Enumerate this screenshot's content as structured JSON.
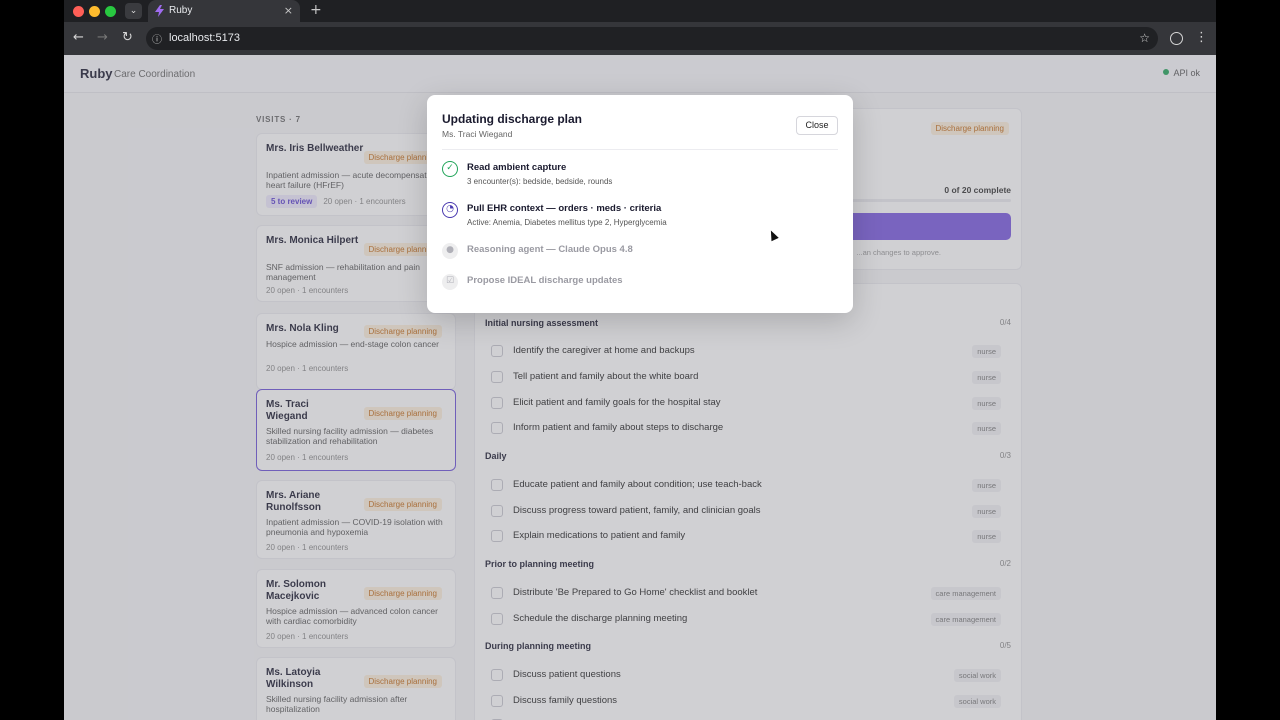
{
  "browser": {
    "tab_title": "Ruby",
    "url": "localhost:5173"
  },
  "app": {
    "brand": "Ruby",
    "section": "Care Coordination",
    "api_status": "API ok"
  },
  "visits": {
    "label": "VISITS · 7",
    "items": [
      {
        "name": "Mrs. Iris Bellweather",
        "badge": "Discharge planning",
        "desc": "Inpatient admission — acute decompensated heart failure (HFrEF)",
        "review": "5 to review",
        "meta": "20 open · 1 encounters"
      },
      {
        "name": "Mrs. Monica Hilpert",
        "badge": "Discharge planning",
        "desc": "SNF admission — rehabilitation and pain management",
        "review": "",
        "meta": "20 open · 1 encounters"
      },
      {
        "name": "Mrs. Nola Kling",
        "badge": "Discharge planning",
        "desc": "Hospice admission — end-stage colon cancer",
        "review": "",
        "meta": "20 open · 1 encounters"
      },
      {
        "name": "Ms. Traci Wiegand",
        "badge": "Discharge planning",
        "desc": "Skilled nursing facility admission — diabetes stabilization and rehabilitation",
        "review": "",
        "meta": "20 open · 1 encounters"
      },
      {
        "name": "Mrs. Ariane Runolfsson",
        "badge": "Discharge planning",
        "desc": "Inpatient admission — COVID-19 isolation with pneumonia and hypoxemia",
        "review": "",
        "meta": "20 open · 1 encounters"
      },
      {
        "name": "Mr. Solomon Macejkovic",
        "badge": "Discharge planning",
        "desc": "Hospice admission — advanced colon cancer with cardiac comorbidity",
        "review": "",
        "meta": "20 open · 1 encounters"
      },
      {
        "name": "Ms. Latoyia Wilkinson",
        "badge": "Discharge planning",
        "desc": "Skilled nursing facility admission after hospitalization",
        "review": "",
        "meta": ""
      }
    ]
  },
  "detail": {
    "badge": "Discharge planning",
    "progress_text": "0 of 20 complete",
    "progress_fraction": 0,
    "hint": "...an changes to approve."
  },
  "sections": [
    {
      "title": "Initial nursing assessment",
      "count": "0/4",
      "tasks": [
        {
          "label": "Identify the caregiver at home and backups",
          "role": "nurse"
        },
        {
          "label": "Tell patient and family about the white board",
          "role": "nurse"
        },
        {
          "label": "Elicit patient and family goals for the hospital stay",
          "role": "nurse"
        },
        {
          "label": "Inform patient and family about steps to discharge",
          "role": "nurse"
        }
      ]
    },
    {
      "title": "Daily",
      "count": "0/3",
      "tasks": [
        {
          "label": "Educate patient and family about condition; use teach-back",
          "role": "nurse"
        },
        {
          "label": "Discuss progress toward patient, family, and clinician goals",
          "role": "nurse"
        },
        {
          "label": "Explain medications to patient and family",
          "role": "nurse"
        }
      ]
    },
    {
      "title": "Prior to planning meeting",
      "count": "0/2",
      "tasks": [
        {
          "label": "Distribute 'Be Prepared to Go Home' checklist and booklet",
          "role": "care management"
        },
        {
          "label": "Schedule the discharge planning meeting",
          "role": "care management"
        }
      ]
    },
    {
      "title": "During planning meeting",
      "count": "0/5",
      "tasks": [
        {
          "label": "Discuss patient questions",
          "role": "social work"
        },
        {
          "label": "Discuss family questions",
          "role": "social work"
        }
      ]
    }
  ],
  "modal": {
    "title": "Updating discharge plan",
    "subtitle": "Ms. Traci Wiegand",
    "close_label": "Close",
    "steps": [
      {
        "title": "Read ambient capture",
        "detail": "3 encounter(s): bedside, bedside, rounds",
        "state": "done",
        "icon": "check-icon"
      },
      {
        "title": "Pull EHR context — orders · meds · criteria",
        "detail": "Active: Anemia, Diabetes mellitus type 2, Hyperglycemia",
        "state": "active",
        "icon": "spinner-icon"
      },
      {
        "title": "Reasoning agent — Claude Opus 4.8",
        "detail": "",
        "state": "pending",
        "icon": "brain-icon"
      },
      {
        "title": "Propose IDEAL discharge updates",
        "detail": "",
        "state": "pending",
        "icon": "checkbox-icon"
      }
    ]
  }
}
